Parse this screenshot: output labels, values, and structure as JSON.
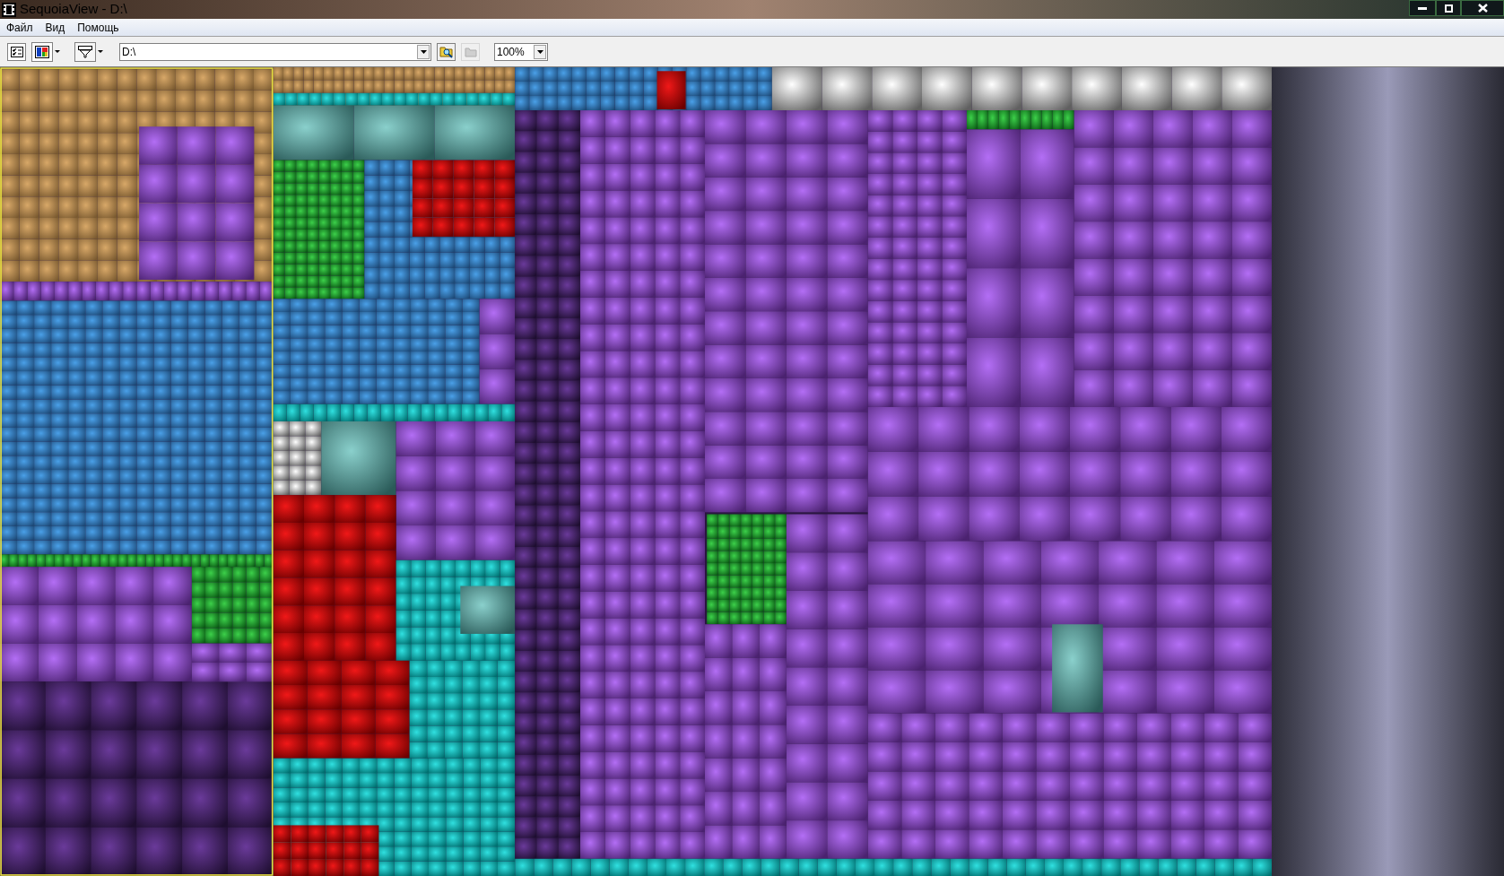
{
  "window": {
    "title": "SequoiaView - D:\\"
  },
  "menu": [
    {
      "label": "Файл"
    },
    {
      "label": "Вид"
    },
    {
      "label": "Помощь"
    }
  ],
  "toolbar": {
    "path": "D:\\",
    "zoom": "100%",
    "folder_button": {
      "disabled": true
    }
  }
}
